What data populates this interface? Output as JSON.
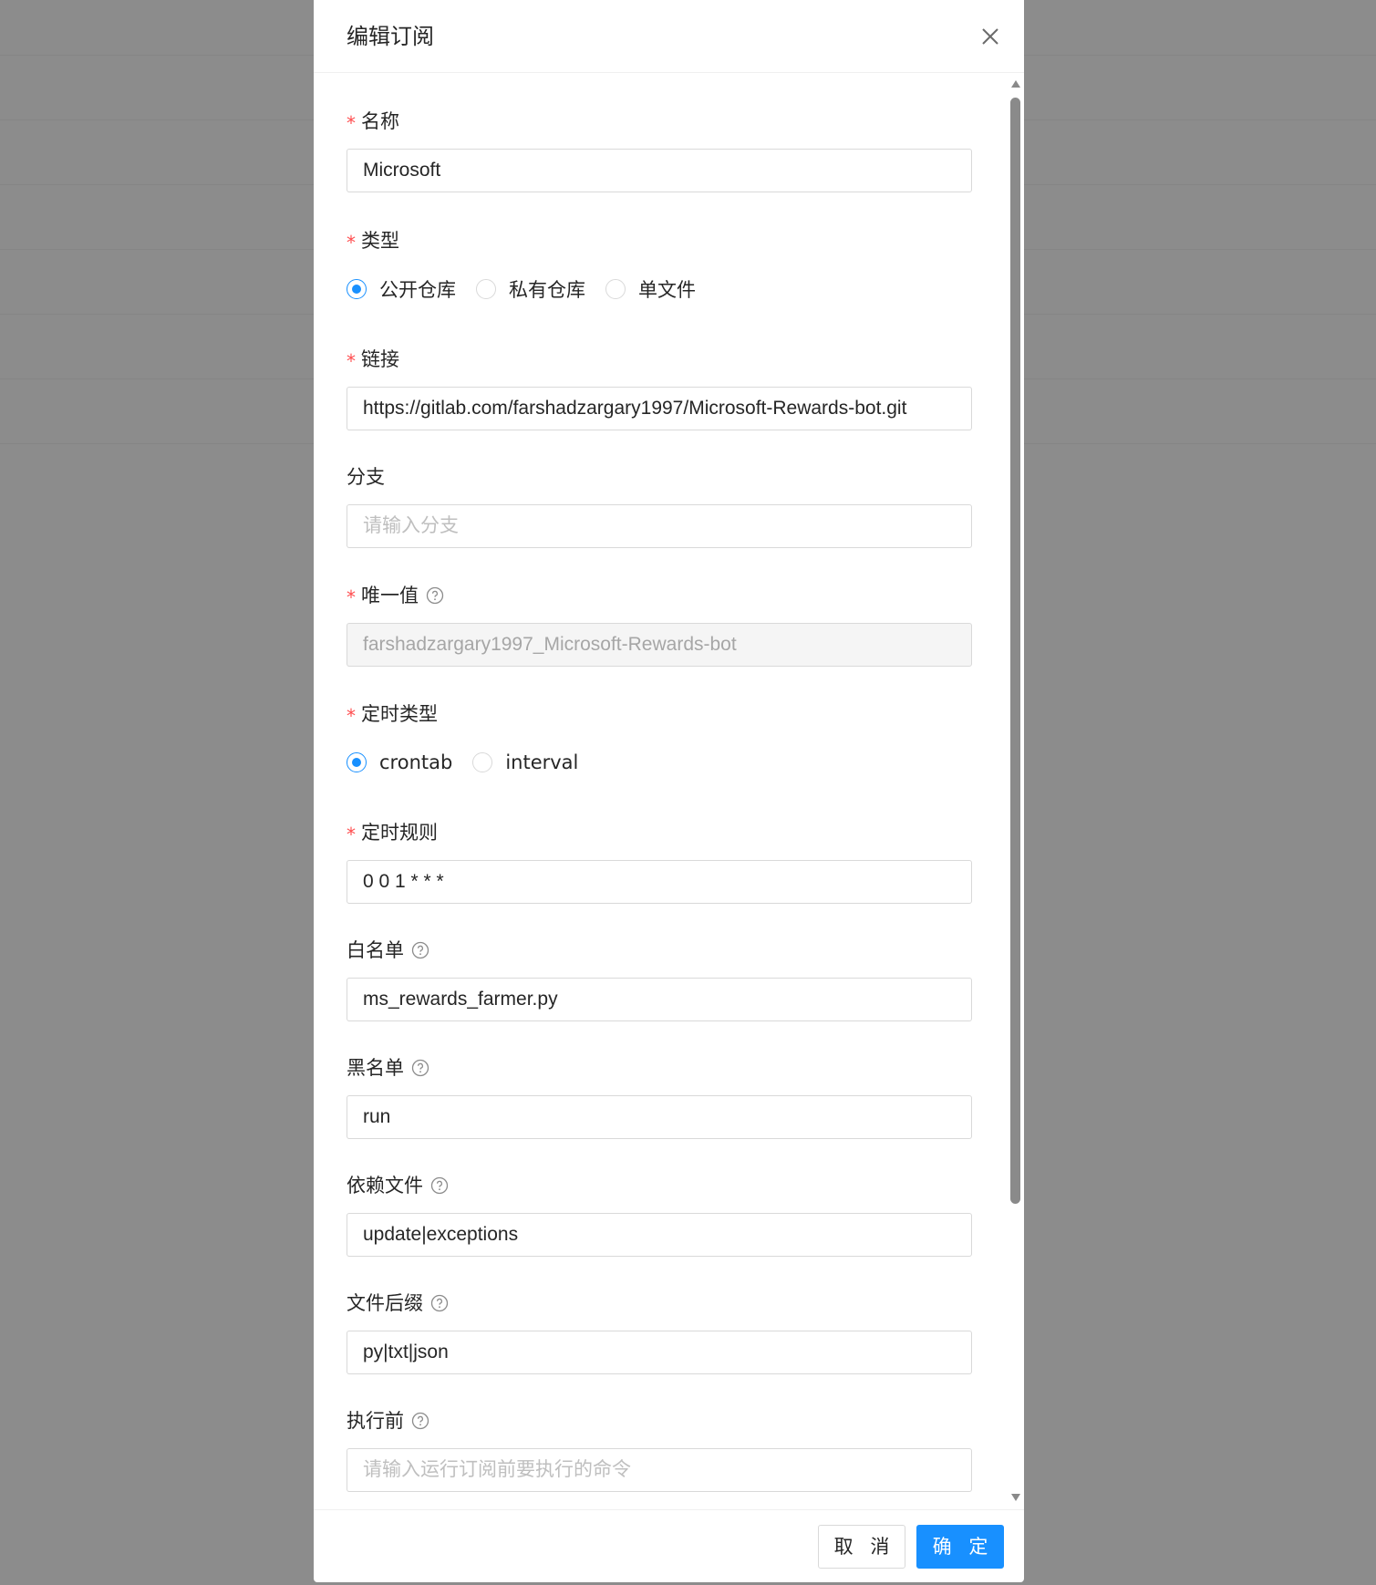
{
  "dialog": {
    "title": "编辑订阅",
    "close_icon": "close-icon"
  },
  "form": {
    "name": {
      "label": "名称",
      "required": "*",
      "value": "Microsoft"
    },
    "type": {
      "label": "类型",
      "required": "*",
      "options": [
        "公开仓库",
        "私有仓库",
        "单文件"
      ],
      "selected": "公开仓库"
    },
    "url": {
      "label": "链接",
      "required": "*",
      "value": "https://gitlab.com/farshadzargary1997/Microsoft-Rewards-bot.git"
    },
    "branch": {
      "label": "分支",
      "placeholder": "请输入分支"
    },
    "alias": {
      "label": "唯一值",
      "required": "*",
      "value": "farshadzargary1997_Microsoft-Rewards-bot"
    },
    "schedule_type": {
      "label": "定时类型",
      "required": "*",
      "options": [
        "crontab",
        "interval"
      ],
      "selected": "crontab"
    },
    "schedule": {
      "label": "定时规则",
      "required": "*",
      "value": "0 0 1 * * *"
    },
    "whitelist": {
      "label": "白名单",
      "value": "ms_rewards_farmer.py"
    },
    "blacklist": {
      "label": "黑名单",
      "value": "run"
    },
    "dependences": {
      "label": "依赖文件",
      "value": "update|exceptions"
    },
    "extensions": {
      "label": "文件后缀",
      "value": "py|txt|json"
    },
    "sub_before": {
      "label": "执行前",
      "placeholder": "请输入运行订阅前要执行的命令"
    }
  },
  "footer": {
    "cancel_label": "取 消",
    "ok_label": "确 定"
  },
  "colors": {
    "primary": "#1890ff",
    "required": "#ff4d4f",
    "overlay": "#8c8c8c"
  }
}
